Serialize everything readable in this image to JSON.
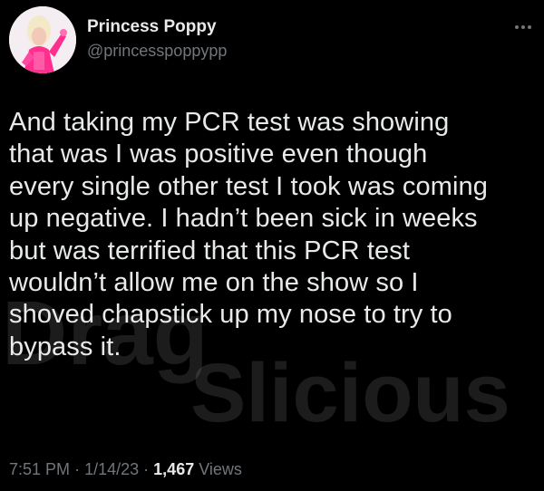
{
  "author": {
    "display_name": "Princess Poppy",
    "handle": "@princesspoppypp",
    "avatar": "avatar-image"
  },
  "menu": {
    "icon": "more-horizontal-icon"
  },
  "tweet": {
    "lines": [
      "And taking my PCR test was showing",
      "that was I was positive even though",
      "every single other test I took was coming",
      "up negative. I hadn’t been sick in weeks",
      "but was terrified that this PCR test",
      "wouldn’t allow me on the show so I",
      "shoved chapstick up my nose to try to",
      "bypass it."
    ]
  },
  "meta": {
    "time": "7:51 PM",
    "separator": "·",
    "date": "1/14/23",
    "views_count": "1,467",
    "views_label": "Views"
  },
  "watermark": {
    "line1": "Drag",
    "line2": "Slicious"
  },
  "colors": {
    "background": "#000000",
    "text_primary": "#e7e9ea",
    "text_secondary": "#71767b"
  }
}
